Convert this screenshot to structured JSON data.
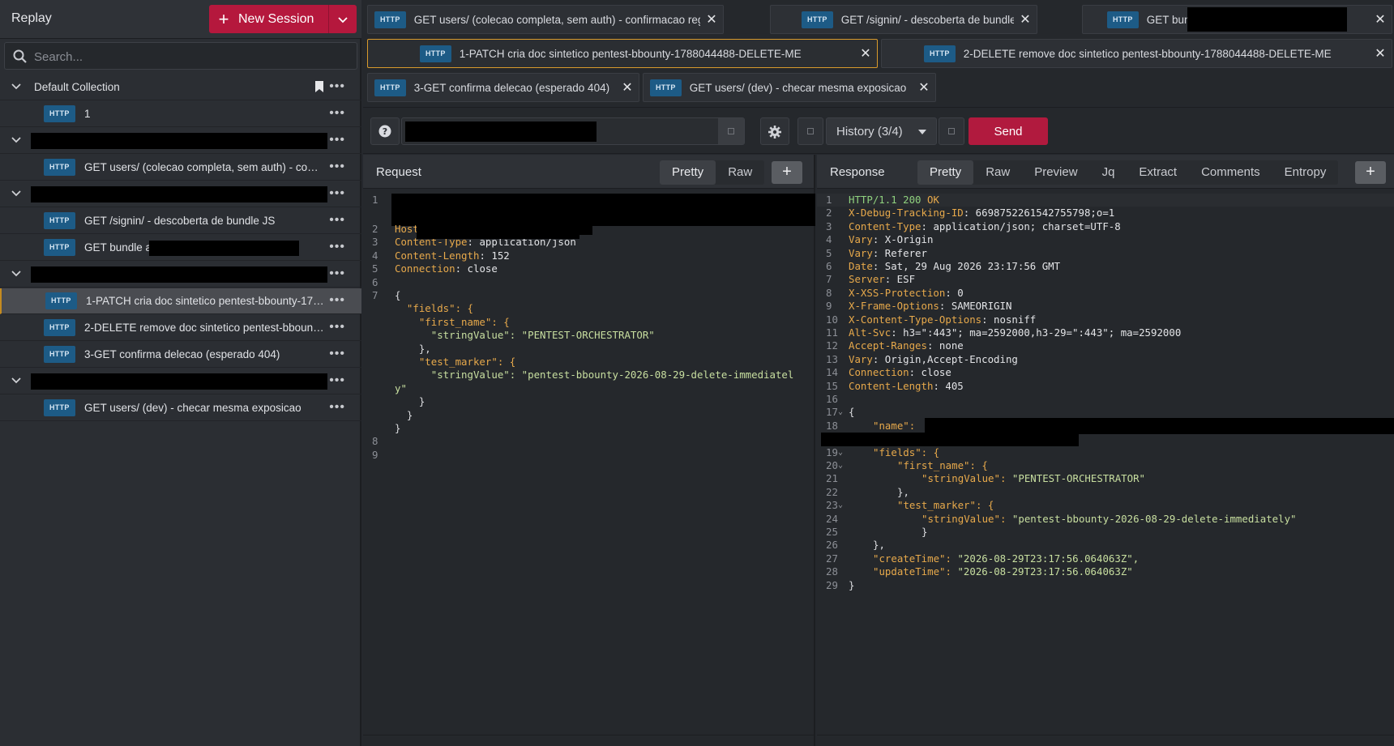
{
  "app": {
    "title": "Replay"
  },
  "new_session": {
    "label": "New Session"
  },
  "search": {
    "placeholder": "Search..."
  },
  "tree": {
    "default_collection": "Default Collection",
    "item_1": "1",
    "req_a": "GET users/ (colecao completa, sem auth) - con…",
    "req_b": "GET /signin/ - descoberta de bundle JS",
    "req_c": "GET bundle a",
    "req_d": "1-PATCH cria doc sintetico pentest-bbounty-17…",
    "req_e": "2-DELETE remove doc sintetico pentest-bboun…",
    "req_f": "3-GET confirma delecao (esperado 404)",
    "req_g": "GET users/ (dev) - checar mesma exposicao",
    "badge": "HTTP",
    "dots": "•••"
  },
  "tabs": [
    {
      "label": "GET users/ (colecao completa, sem auth) - confirmacao registrada"
    },
    {
      "label": "GET /signin/ - descoberta de bundle JS"
    },
    {
      "label": "GET bundl"
    },
    {
      "label": "1-PATCH cria doc sintetico pentest-bbounty-1788044488-DELETE-ME"
    },
    {
      "label": "2-DELETE remove doc sintetico pentest-bbounty-1788044488-DELETE-ME"
    },
    {
      "label": "3-GET confirma delecao (esperado 404)"
    },
    {
      "label": "GET users/ (dev) - checar mesma exposicao"
    }
  ],
  "toolbar": {
    "history": "History (3/4)",
    "send": "Send"
  },
  "request": {
    "title": "Request",
    "view_pretty": "Pretty",
    "view_raw": "Raw",
    "lines": [
      {
        "n": "1"
      },
      {
        "n": "2",
        "k": "Host",
        "v": ""
      },
      {
        "n": "3",
        "k": "Content-Type",
        "v": ": application/json"
      },
      {
        "n": "4",
        "k": "Content-Length",
        "v": ": 152"
      },
      {
        "n": "5",
        "k": "Connection",
        "v": ": close"
      },
      {
        "n": "6"
      },
      {
        "n": "7",
        "t": "{"
      },
      {
        "t": "  \"fields\": {"
      },
      {
        "t": "    \"first_name\": {"
      },
      {
        "t": "      \"stringValue\": \"PENTEST-ORCHESTRATOR\""
      },
      {
        "t": "    },"
      },
      {
        "t": "    \"test_marker\": {"
      },
      {
        "t": "      \"stringValue\": \"pentest-bbounty-2026-08-29-delete-immediatel"
      },
      {
        "t": "y\""
      },
      {
        "t": "    }"
      },
      {
        "t": "  }"
      },
      {
        "t": "}"
      },
      {
        "n": "8"
      },
      {
        "n": "9"
      }
    ]
  },
  "response": {
    "title": "Response",
    "views": [
      "Pretty",
      "Raw",
      "Preview",
      "Jq",
      "Extract",
      "Comments",
      "Entropy"
    ],
    "status": {
      "proto": "HTTP/1.1 200 ",
      "ok": "OK"
    },
    "headers": [
      {
        "k": "X-Debug-Tracking-ID",
        "v": ": 6698752261542755798;o=1"
      },
      {
        "k": "Content-Type",
        "v": ": application/json; charset=UTF-8"
      },
      {
        "k": "Vary",
        "v": ": X-Origin"
      },
      {
        "k": "Vary",
        "v": ": Referer"
      },
      {
        "k": "Date",
        "v": ": Sat, 29 Aug 2026 23:17:56 GMT"
      },
      {
        "k": "Server",
        "v": ": ESF"
      },
      {
        "k": "X-XSS-Protection",
        "v": ": 0"
      },
      {
        "k": "X-Frame-Options",
        "v": ": SAMEORIGIN"
      },
      {
        "k": "X-Content-Type-Options",
        "v": ": nosniff"
      },
      {
        "k": "Alt-Svc",
        "v": ": h3=\":443\"; ma=2592000,h3-29=\":443\"; ma=2592000"
      },
      {
        "k": "Accept-Ranges",
        "v": ": none"
      },
      {
        "k": "Vary",
        "v": ": Origin,Accept-Encoding"
      },
      {
        "k": "Connection",
        "v": ": close"
      },
      {
        "k": "Content-Length",
        "v": ": 405"
      }
    ],
    "body": {
      "name_key": "\"name\": ",
      "fields": "\"fields\": {",
      "first_name": "\"first_name\": {",
      "sv_key": "\"stringValue\": ",
      "first_val": "\"PENTEST-ORCHESTRATOR\"",
      "test_marker": "\"test_marker\": {",
      "marker_val": "\"pentest-bbounty-2026-08-29-delete-immediately\"",
      "create_key": "\"createTime\": ",
      "create_val": "\"2026-08-29T23:17:56.064063Z\",",
      "update_key": "\"updateTime\": ",
      "update_val": "\"2026-08-29T23:17:56.064063Z\""
    }
  },
  "colors": {
    "accent_red": "#b5183d",
    "badge_blue": "#1d5b86",
    "active_tab_border": "#d89a2c",
    "header_key": "#e7a94b"
  },
  "icons": [
    "search-icon",
    "chevron-down-icon",
    "bookmark-icon",
    "more-icon",
    "close-icon",
    "help-icon",
    "gear-icon",
    "plus-icon",
    "caret-down-icon"
  ]
}
